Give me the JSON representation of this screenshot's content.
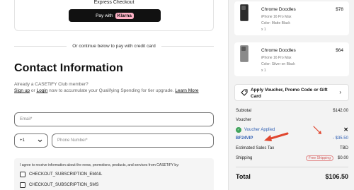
{
  "express": {
    "title": "Express Checkout",
    "pay_with": "Pay with",
    "klarna": "Klarna"
  },
  "divider_text": "Or continue below to pay with credit card",
  "contact": {
    "title": "Contact Information",
    "club_line1": "Already a CASETiFY Club member?",
    "sign_up": "Sign up",
    "or": " or ",
    "login": "Login",
    "club_line2": " now to accumulate your Qualifying Spending for tier upgrade. ",
    "learn_more": "Learn More",
    "email_placeholder": "Email*",
    "country_code": "+1",
    "phone_placeholder": "Phone Number*"
  },
  "subscription": {
    "intro": "I agree to receive information about the news, promotions, products, and services from CASETiFY by:",
    "options": [
      "CHECKOUT_SUBSCRIPTION_EMAIL",
      "CHECKOUT_SUBSCRIPTION_SMS"
    ]
  },
  "cart": {
    "items": [
      {
        "name": "Chrome Doodles",
        "price": "$78",
        "model": "iPhone 16 Pro Max",
        "color": "Color: Matte Black",
        "qty": "x 1"
      },
      {
        "name": "Chrome Doodles",
        "price": "$64",
        "model": "iPhone 16 Pro Max",
        "color": "Color: Silver on Black",
        "qty": "x 1"
      }
    ],
    "voucher_cta": "Apply Voucher, Promo Code or Gift Card"
  },
  "summary": {
    "subtotal_label": "Subtotal",
    "subtotal_value": "$142.00",
    "voucher_label": "Voucher",
    "voucher_applied": "Voucher Applied",
    "voucher_code": "BF24VIP",
    "voucher_discount": "- $35.50",
    "tax_label": "Estimated Sales Tax",
    "tax_value": "TBD",
    "shipping_label": "Shipping",
    "shipping_badge": "Free Shipping",
    "shipping_value": "$0.00",
    "total_label": "Total",
    "total_value": "$106.50"
  },
  "colors": {
    "accent_blue": "#2f5fb3",
    "annotation_arrow": "#e0462f",
    "klarna_pink": "#ffb3c7",
    "success_green": "#3ea35a"
  }
}
